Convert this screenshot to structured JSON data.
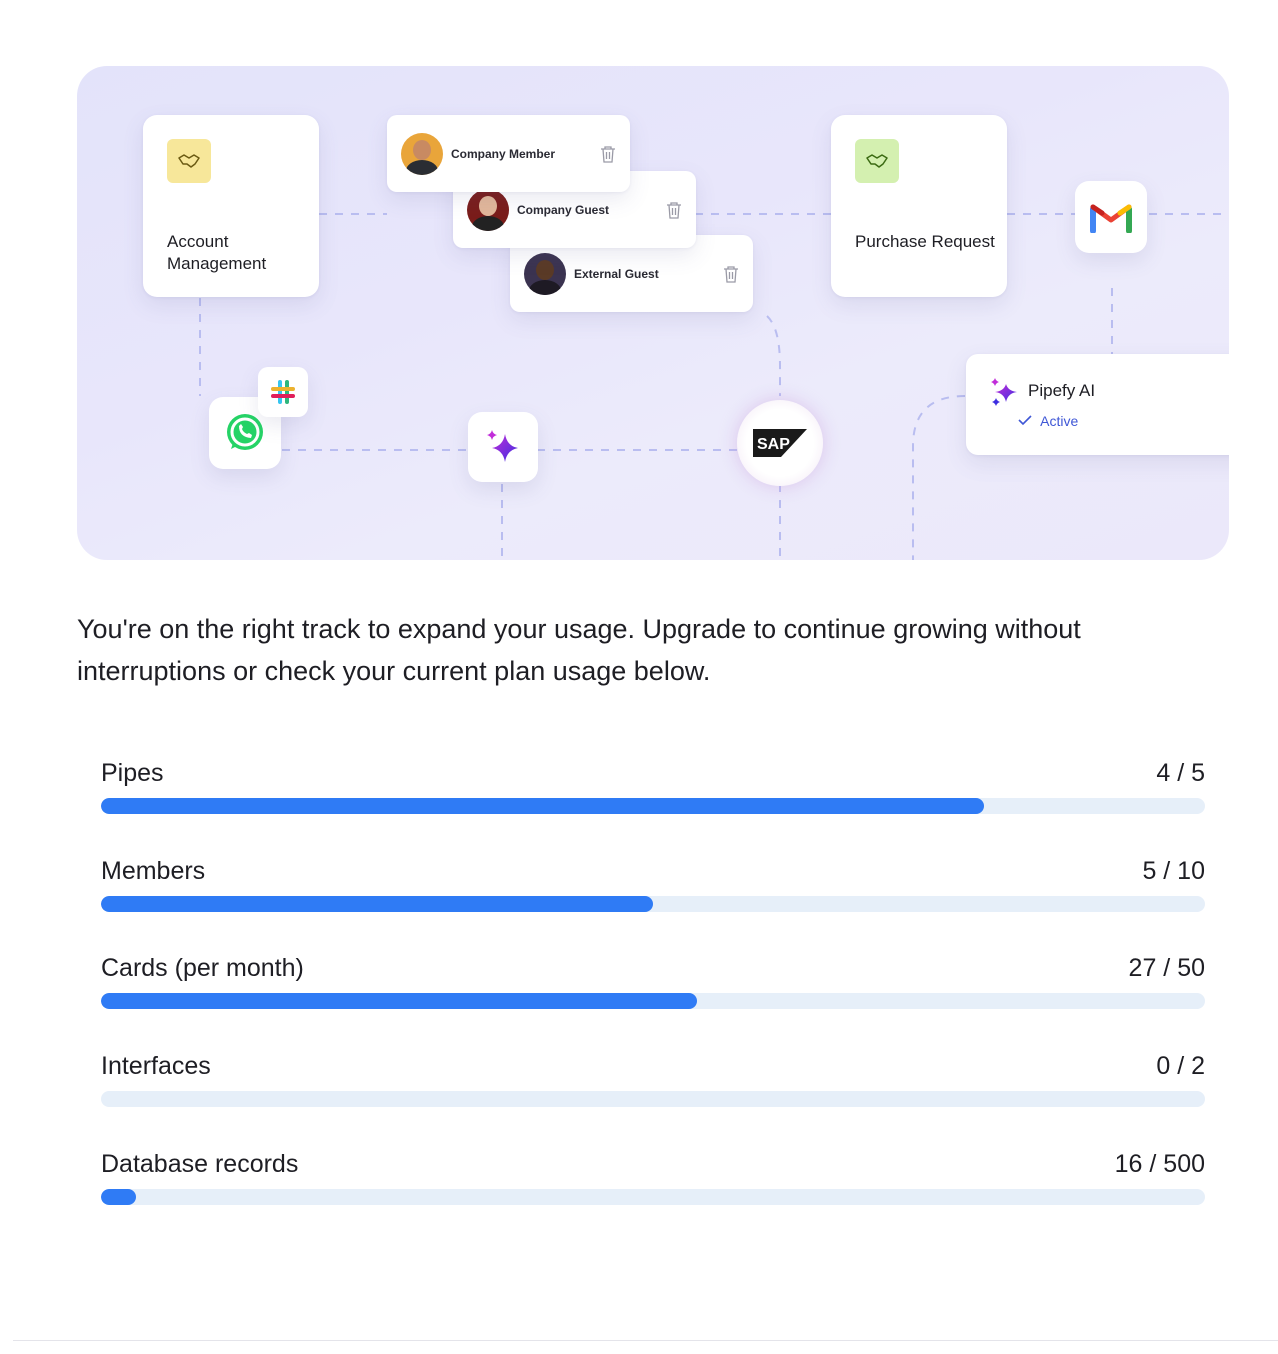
{
  "hero": {
    "task_cards": [
      {
        "title": "Account Management",
        "badge_color": "#f7e79a",
        "icon": "handshake-icon"
      },
      {
        "title": "Purchase Request",
        "badge_color": "#d4f0b0",
        "icon": "handshake-icon"
      }
    ],
    "members": [
      {
        "name": "Company Member",
        "icon": "trash-icon"
      },
      {
        "name": "Company Guest",
        "icon": "trash-icon"
      },
      {
        "name": "External Guest",
        "icon": "trash-icon"
      }
    ],
    "apps": [
      "gmail-icon",
      "slack-icon",
      "whatsapp-icon",
      "sparkle-icon",
      "sap-icon"
    ],
    "ai": {
      "title": "Pipefy AI",
      "status": "Active",
      "status_color": "#3f57d6"
    }
  },
  "intro_text": "You're on the right track to expand your usage. Upgrade to continue growing without interruptions or check your current plan usage below.",
  "usage": [
    {
      "label": "Pipes",
      "count": "4 / 5",
      "used": 4,
      "limit": 5
    },
    {
      "label": "Members",
      "count": "5 / 10",
      "used": 5,
      "limit": 10
    },
    {
      "label": "Cards (per month)",
      "count": "27 / 50",
      "used": 27,
      "limit": 50
    },
    {
      "label": "Interfaces",
      "count": "0 / 2",
      "used": 0,
      "limit": 2
    },
    {
      "label": "Database records",
      "count": "16 / 500",
      "used": 16,
      "limit": 500
    }
  ],
  "colors": {
    "bar_fill": "#2f7bf5",
    "bar_track": "#e6eff9"
  }
}
